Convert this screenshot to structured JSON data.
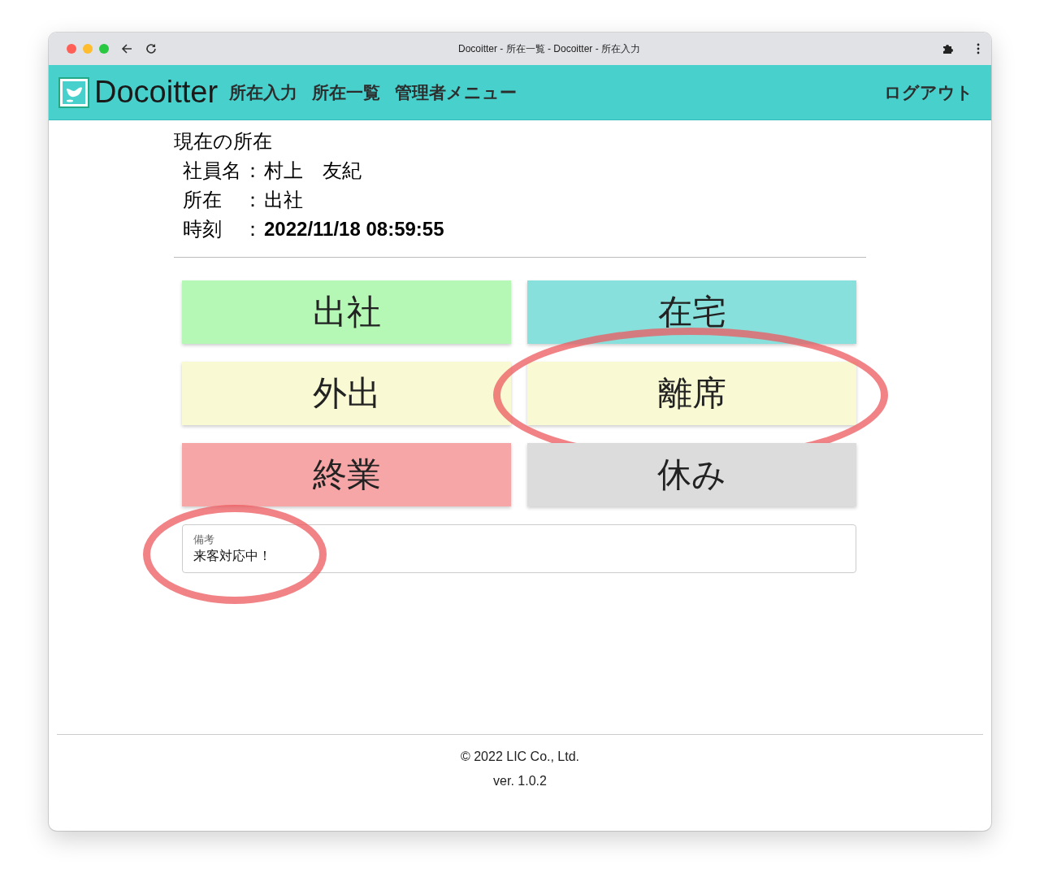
{
  "browser": {
    "title": "Docoitter - 所在一覧 - Docoitter - 所在入力"
  },
  "header": {
    "brand": "Docoitter",
    "nav": [
      {
        "label": "所在入力"
      },
      {
        "label": "所在一覧"
      },
      {
        "label": "管理者メニュー"
      }
    ],
    "logout": "ログアウト"
  },
  "current": {
    "heading": "現在の所在",
    "fields": [
      {
        "label": "社員名",
        "separator": "：",
        "value": "村上　友紀"
      },
      {
        "label": "所在",
        "separator": "：",
        "value": "出社"
      },
      {
        "label": "時刻",
        "separator": "：",
        "value": "2022/11/18 08:59:55"
      }
    ]
  },
  "statuses": [
    {
      "label": "出社",
      "color": "#b5f7b5",
      "highlighted": false
    },
    {
      "label": "在宅",
      "color": "#88e0dc",
      "highlighted": false
    },
    {
      "label": "外出",
      "color": "#f9f9d3",
      "highlighted": false
    },
    {
      "label": "離席",
      "color": "#f9f9d3",
      "highlighted": true
    },
    {
      "label": "終業",
      "color": "#f6a6a6",
      "highlighted": false
    },
    {
      "label": "休み",
      "color": "#dcdcdc",
      "highlighted": false
    }
  ],
  "remark": {
    "label": "備考",
    "value": "来客対応中！",
    "highlighted": true
  },
  "footer": {
    "copyright": "© 2022 LIC Co., Ltd.",
    "version": "ver. 1.0.2"
  }
}
